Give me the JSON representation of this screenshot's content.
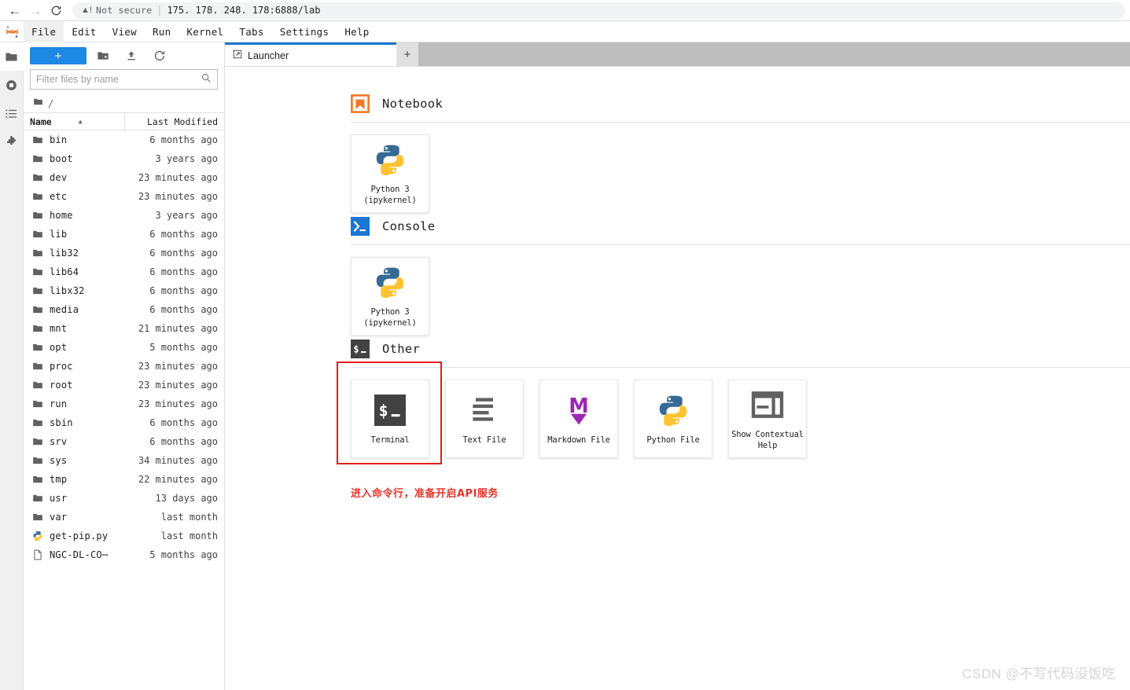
{
  "browser": {
    "back_icon": "arrow-left-icon",
    "forward_icon": "arrow-right-icon",
    "reload_icon": "reload-icon",
    "warning_icon": "warning-triangle-icon",
    "security_label": "Not secure",
    "separator": "|",
    "url": "175. 178. 248. 178:6888/lab"
  },
  "menubar": {
    "logo": "jupyter-logo",
    "items": [
      {
        "label": "File",
        "active": true
      },
      {
        "label": "Edit",
        "active": false
      },
      {
        "label": "View",
        "active": false
      },
      {
        "label": "Run",
        "active": false
      },
      {
        "label": "Kernel",
        "active": false
      },
      {
        "label": "Tabs",
        "active": false
      },
      {
        "label": "Settings",
        "active": false
      },
      {
        "label": "Help",
        "active": false
      }
    ]
  },
  "activitybar": {
    "items": [
      {
        "name": "file-browser-icon",
        "selected": true
      },
      {
        "name": "running-terminals-icon",
        "selected": false
      },
      {
        "name": "commands-list-icon",
        "selected": false
      },
      {
        "name": "extension-manager-icon",
        "selected": false
      }
    ]
  },
  "filebrowser": {
    "new_launcher_label": "+",
    "new_folder_icon": "new-folder-icon",
    "upload_icon": "upload-icon",
    "refresh_icon": "refresh-icon",
    "filter_placeholder": "Filter files by name",
    "filter_value": "",
    "search_icon": "search-icon",
    "breadcrumb_root": "/",
    "breadcrumb_icon": "folder-icon",
    "columns": {
      "name": "Name",
      "last_modified": "Last Modified",
      "sort_caret": "▲"
    },
    "files": [
      {
        "name": "bin",
        "modified": "6 months ago",
        "kind": "folder"
      },
      {
        "name": "boot",
        "modified": "3 years ago",
        "kind": "folder"
      },
      {
        "name": "dev",
        "modified": "23 minutes ago",
        "kind": "folder"
      },
      {
        "name": "etc",
        "modified": "23 minutes ago",
        "kind": "folder"
      },
      {
        "name": "home",
        "modified": "3 years ago",
        "kind": "folder"
      },
      {
        "name": "lib",
        "modified": "6 months ago",
        "kind": "folder"
      },
      {
        "name": "lib32",
        "modified": "6 months ago",
        "kind": "folder"
      },
      {
        "name": "lib64",
        "modified": "6 months ago",
        "kind": "folder"
      },
      {
        "name": "libx32",
        "modified": "6 months ago",
        "kind": "folder"
      },
      {
        "name": "media",
        "modified": "6 months ago",
        "kind": "folder"
      },
      {
        "name": "mnt",
        "modified": "21 minutes ago",
        "kind": "folder"
      },
      {
        "name": "opt",
        "modified": "5 months ago",
        "kind": "folder"
      },
      {
        "name": "proc",
        "modified": "23 minutes ago",
        "kind": "folder"
      },
      {
        "name": "root",
        "modified": "23 minutes ago",
        "kind": "folder"
      },
      {
        "name": "run",
        "modified": "23 minutes ago",
        "kind": "folder"
      },
      {
        "name": "sbin",
        "modified": "6 months ago",
        "kind": "folder"
      },
      {
        "name": "srv",
        "modified": "6 months ago",
        "kind": "folder"
      },
      {
        "name": "sys",
        "modified": "34 minutes ago",
        "kind": "folder"
      },
      {
        "name": "tmp",
        "modified": "22 minutes ago",
        "kind": "folder"
      },
      {
        "name": "usr",
        "modified": "13 days ago",
        "kind": "folder"
      },
      {
        "name": "var",
        "modified": "last month",
        "kind": "folder"
      },
      {
        "name": "get-pip.py",
        "modified": "last month",
        "kind": "python"
      },
      {
        "name": "NGC-DL-CO⋯",
        "modified": "5 months ago",
        "kind": "file"
      }
    ]
  },
  "tabbar": {
    "tabs": [
      {
        "label": "Launcher",
        "icon": "launcher-icon",
        "active": true
      }
    ],
    "add_tab_label": "+"
  },
  "launcher": {
    "sections": [
      {
        "id": "notebook",
        "title": "Notebook",
        "icon": "notebook-bookmark-icon",
        "cards": [
          {
            "label": "Python 3\n(ipykernel)",
            "icon": "python-logo-icon",
            "highlighted": false
          }
        ]
      },
      {
        "id": "console",
        "title": "Console",
        "icon": "console-prompt-icon",
        "cards": [
          {
            "label": "Python 3\n(ipykernel)",
            "icon": "python-logo-icon",
            "highlighted": false
          }
        ]
      },
      {
        "id": "other",
        "title": "Other",
        "icon": "terminal-dollar-icon",
        "cards": [
          {
            "label": "Terminal",
            "icon": "terminal-dollar-icon",
            "highlighted": true
          },
          {
            "label": "Text File",
            "icon": "text-lines-icon",
            "highlighted": false
          },
          {
            "label": "Markdown File",
            "icon": "markdown-m-icon",
            "highlighted": false
          },
          {
            "label": "Python File",
            "icon": "python-logo-icon",
            "highlighted": false
          },
          {
            "label": "Show Contextual\nHelp",
            "icon": "contextual-help-icon",
            "highlighted": false
          }
        ]
      }
    ],
    "annotation": "进入命令行，准备开启API服务",
    "annotation_color": "#e8352b",
    "highlight_color": "#e21c1c"
  },
  "watermark": "CSDN @不写代码没饭吃"
}
